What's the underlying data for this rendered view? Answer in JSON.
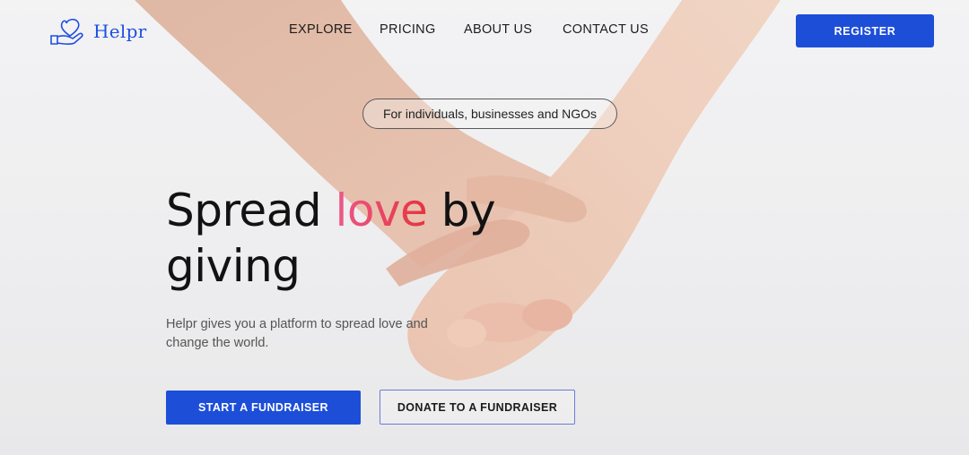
{
  "brand": {
    "name": "Helpr",
    "icon": "heart-hand-icon",
    "color": "#1f4fe0"
  },
  "nav": {
    "items": [
      "EXPLORE",
      "PRICING",
      "ABOUT US",
      "CONTACT US"
    ]
  },
  "header": {
    "register_label": "REGISTER"
  },
  "hero": {
    "pill": "For individuals, businesses and NGOs",
    "title_part1": "Spread ",
    "title_highlight": "love",
    "title_part2": " by",
    "title_line2": "giving",
    "subtitle": "Helpr gives you a platform to spread love and change the world."
  },
  "actions": {
    "primary": "START A FUNDRAISER",
    "secondary": "DONATE TO A FUNDRAISER"
  },
  "colors": {
    "accent": "#1d4ed8",
    "love_start": "#ec5a8a",
    "love_end": "#e5333f"
  }
}
